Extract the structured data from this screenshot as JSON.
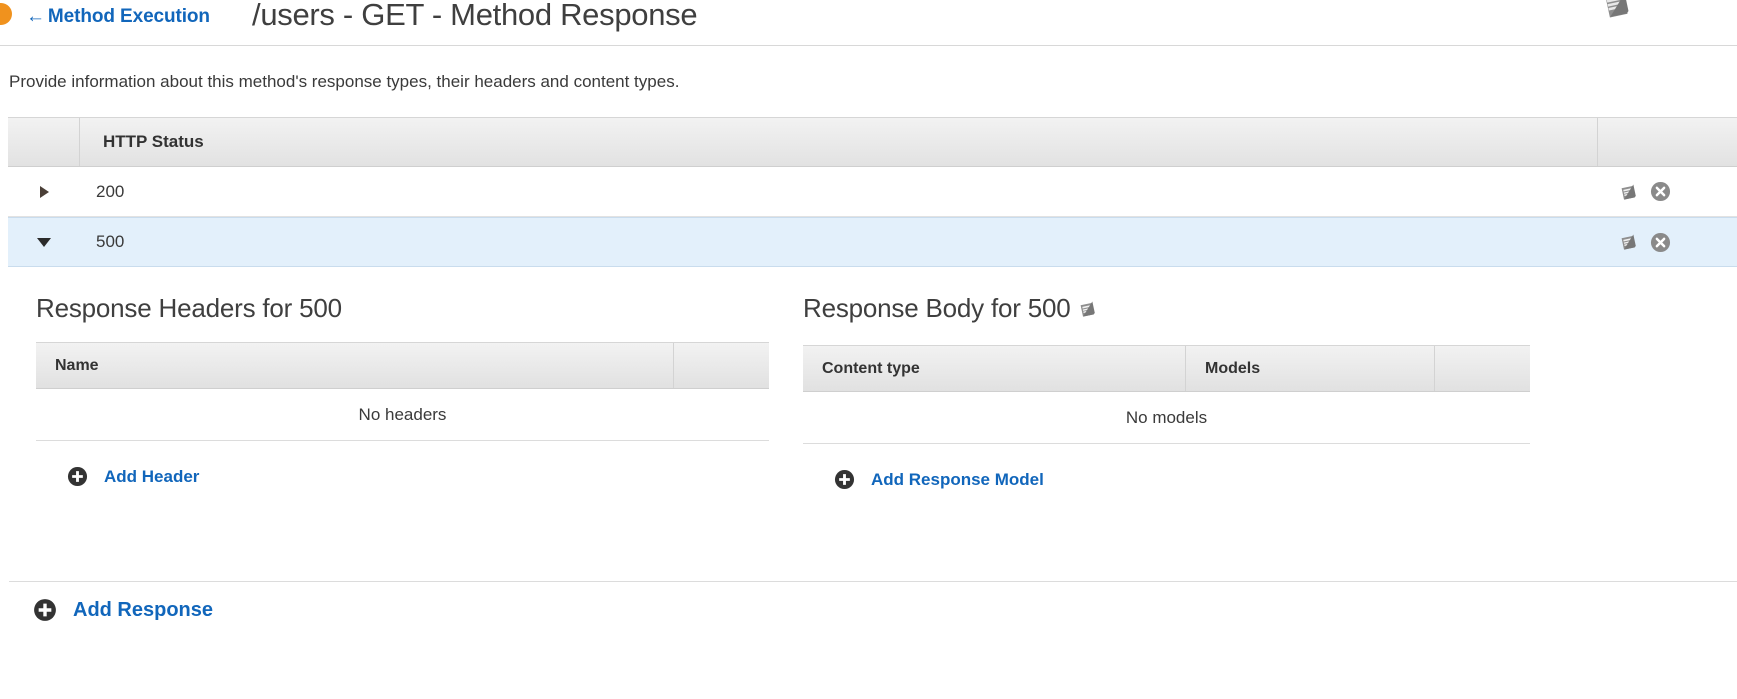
{
  "header": {
    "back_label": "Method Execution",
    "back_arrow_glyph": "←",
    "title": "/users - GET - Method Response",
    "doc_icon": "book-icon",
    "status_indicator_color": "#f0921e",
    "link_color": "#1166bb"
  },
  "description": "Provide information about this method's response types, their headers and content types.",
  "status_table": {
    "columns": [
      "",
      "HTTP Status",
      ""
    ],
    "rows": [
      {
        "status": "200",
        "expanded": false,
        "toggle_icon": "triangle-right-icon",
        "actions": [
          "book-icon",
          "delete-circle-icon"
        ]
      },
      {
        "status": "500",
        "expanded": true,
        "toggle_icon": "triangle-down-icon",
        "actions": [
          "book-icon",
          "delete-circle-icon"
        ]
      }
    ]
  },
  "response_headers": {
    "title": "Response Headers for 500",
    "columns": [
      "Name",
      ""
    ],
    "empty_text": "No headers",
    "add_label": "Add Header",
    "add_icon": "plus-circle-icon"
  },
  "response_body": {
    "title": "Response Body for 500",
    "title_icon": "book-icon",
    "columns": [
      "Content type",
      "Models",
      ""
    ],
    "empty_text": "No models",
    "add_label": "Add Response Model",
    "add_icon": "plus-circle-icon"
  },
  "footer": {
    "add_label": "Add Response",
    "add_icon": "plus-circle-icon"
  },
  "colors": {
    "link": "#1166bb",
    "selected_row": "#e3f0fb",
    "table_header": "#e9e9e9",
    "text": "#3a3a3a",
    "accent_orange": "#f0921e"
  }
}
